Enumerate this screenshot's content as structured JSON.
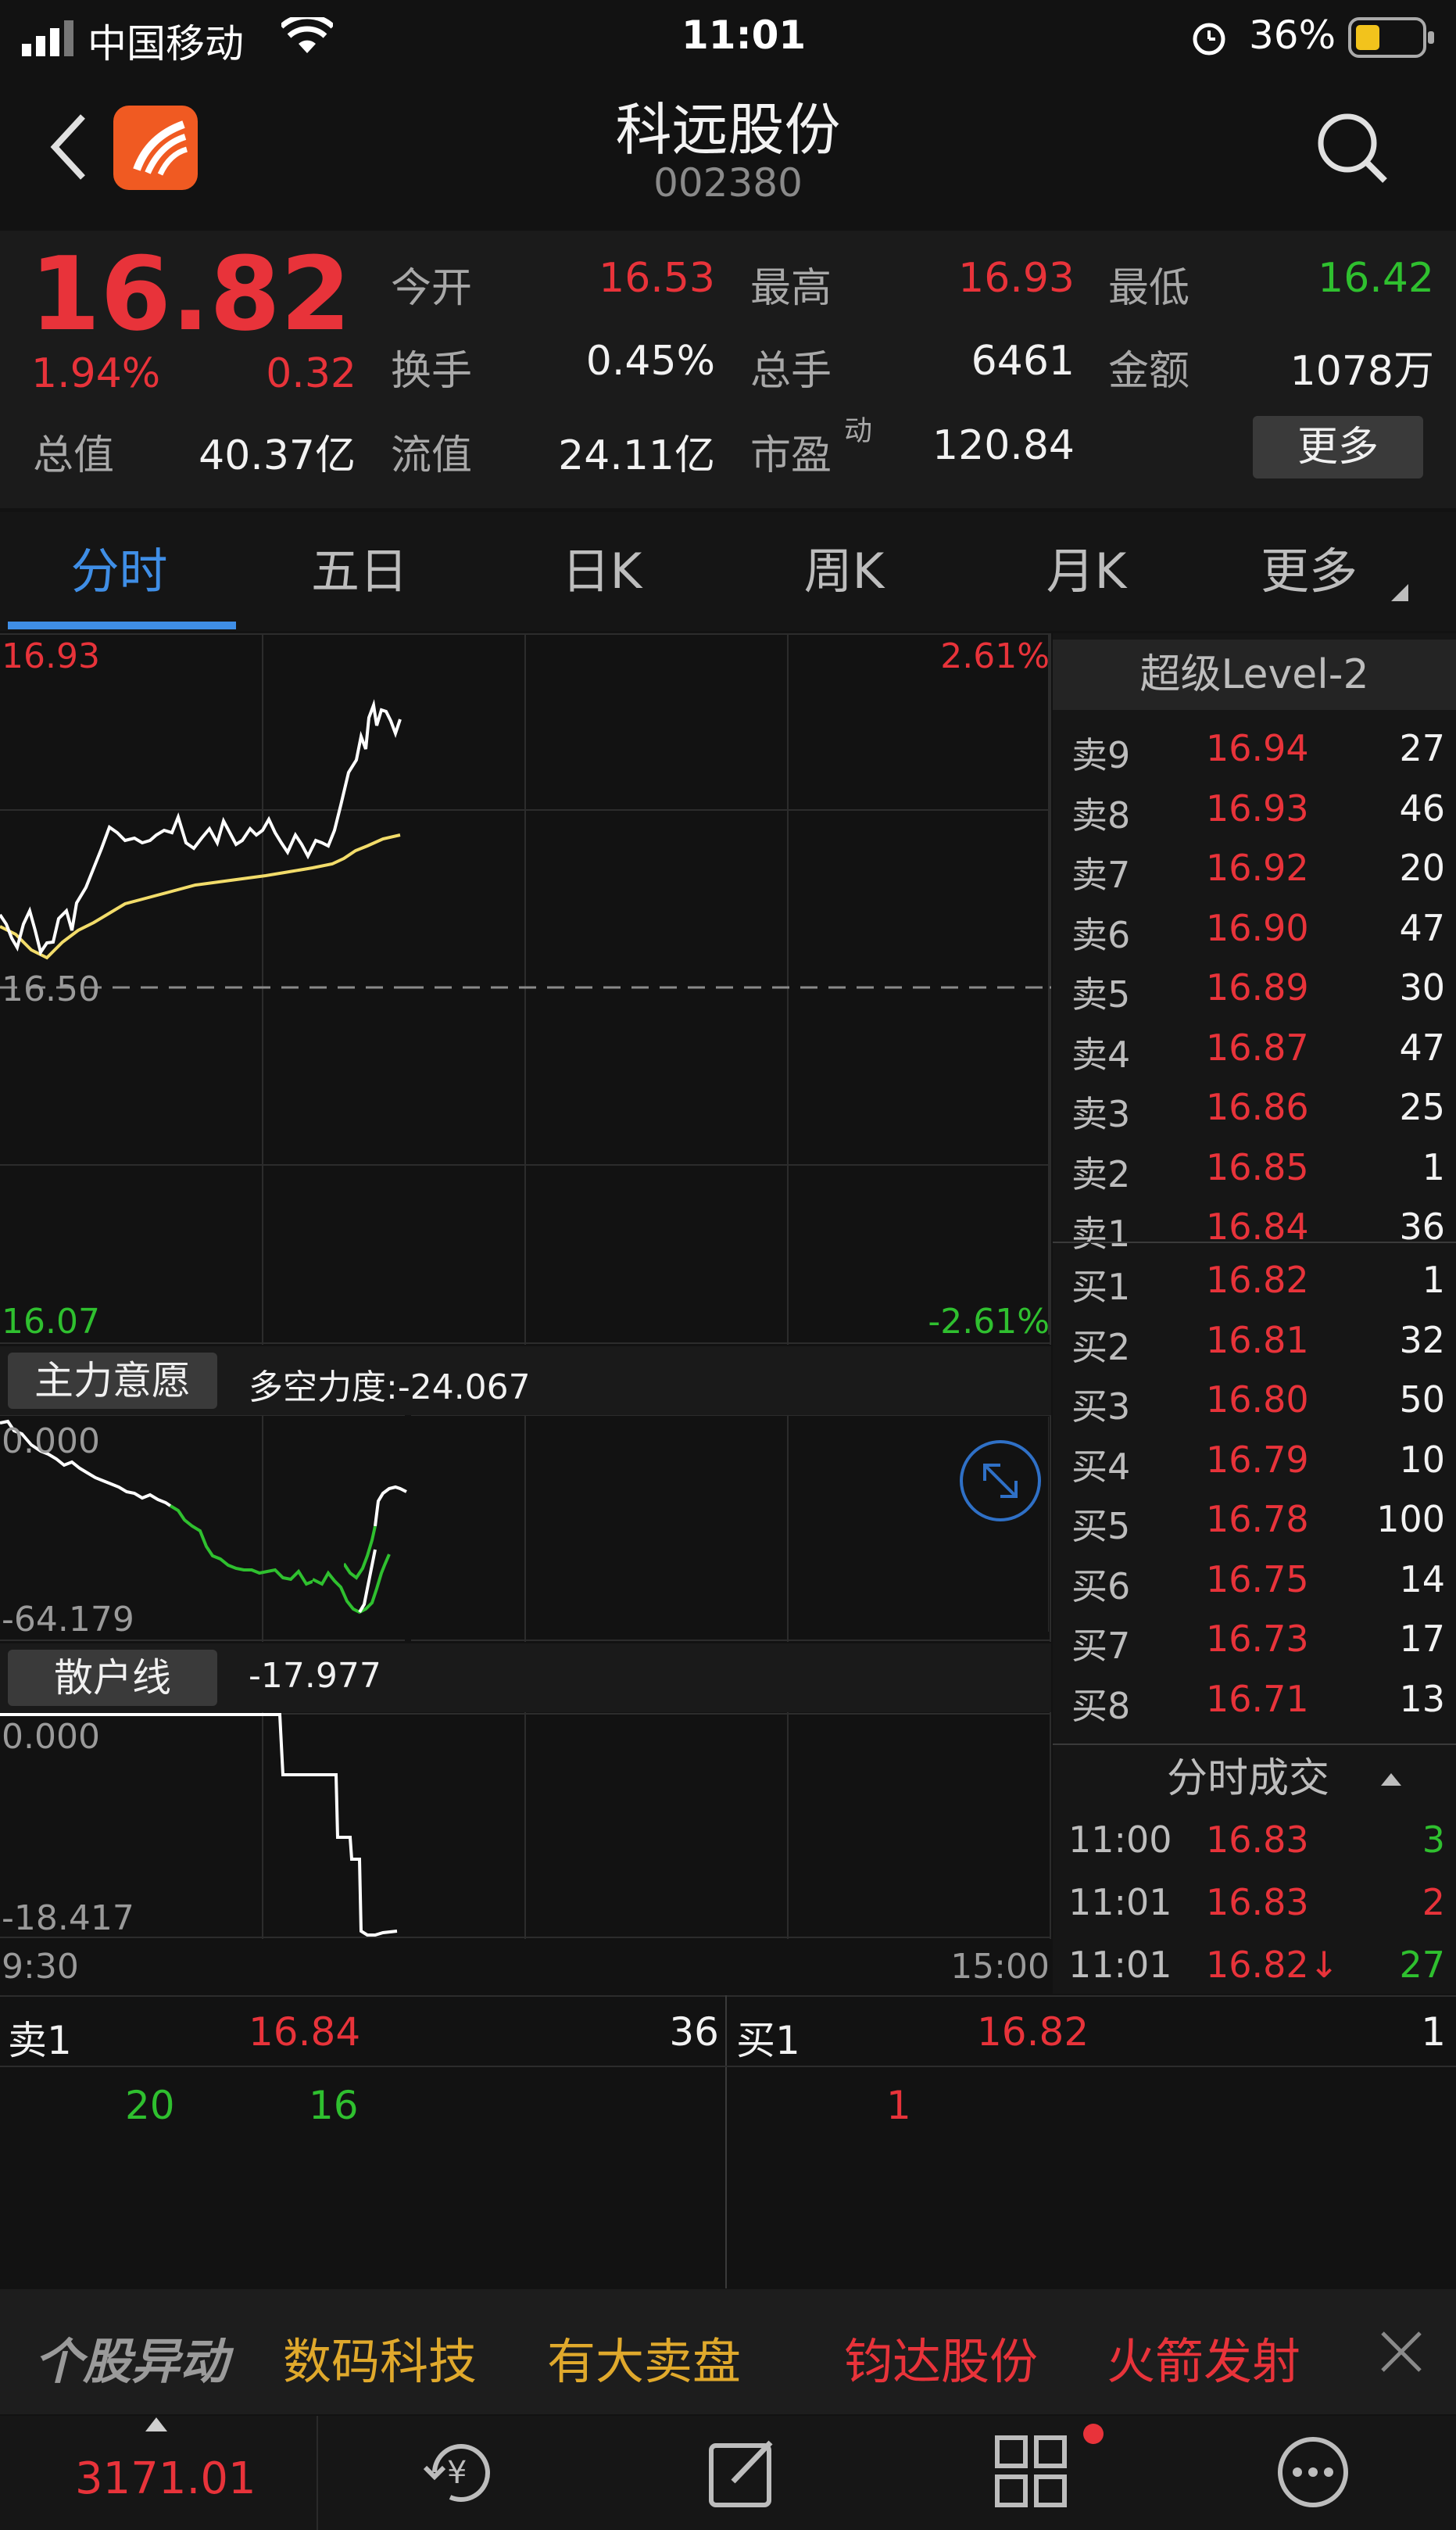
{
  "status_bar": {
    "carrier": "中国移动",
    "time": "11:01",
    "battery": "36%"
  },
  "header": {
    "title": "科远股份",
    "code": "002380"
  },
  "quote": {
    "price": "16.82",
    "change_pct": "1.94%",
    "change": "0.32",
    "rows": [
      [
        {
          "label": "今开",
          "value": "16.53",
          "color": "red"
        },
        {
          "label": "最高",
          "value": "16.93",
          "color": "red"
        },
        {
          "label": "最低",
          "value": "16.42",
          "color": "green"
        }
      ],
      [
        {
          "label": "换手",
          "value": "0.45%",
          "color": "white"
        },
        {
          "label": "总手",
          "value": "6461",
          "color": "white"
        },
        {
          "label": "金额",
          "value": "1078万",
          "color": "white"
        }
      ]
    ],
    "total_value_label": "总值",
    "total_value": "40.37亿",
    "float_value_label": "流值",
    "float_value": "24.11亿",
    "pe_label": "市盈",
    "pe_sup": "动",
    "pe_value": "120.84",
    "more_label": "更多"
  },
  "tabs": [
    "分时",
    "五日",
    "日K",
    "周K",
    "月K",
    "更多"
  ],
  "chart": {
    "price_high": "16.93",
    "pct_high": "2.61%",
    "price_mid": "16.50",
    "price_low": "16.07",
    "pct_low": "-2.61%",
    "time_start": "9:30",
    "time_end": "15:00"
  },
  "indicator1": {
    "button": "主力意愿",
    "text": "多空力度:-24.067",
    "top_val": "0.000",
    "bottom_val": "-64.179"
  },
  "indicator2": {
    "button": "散户线",
    "text": "-17.977",
    "top_val": "0.000",
    "bottom_val": "-18.417"
  },
  "order_book": {
    "title": "超级Level-2",
    "sells": [
      {
        "label": "卖9",
        "price": "16.94",
        "vol": "27"
      },
      {
        "label": "卖8",
        "price": "16.93",
        "vol": "46"
      },
      {
        "label": "卖7",
        "price": "16.92",
        "vol": "20"
      },
      {
        "label": "卖6",
        "price": "16.90",
        "vol": "47"
      },
      {
        "label": "卖5",
        "price": "16.89",
        "vol": "30"
      },
      {
        "label": "卖4",
        "price": "16.87",
        "vol": "47"
      },
      {
        "label": "卖3",
        "price": "16.86",
        "vol": "25"
      },
      {
        "label": "卖2",
        "price": "16.85",
        "vol": "1"
      },
      {
        "label": "卖1",
        "price": "16.84",
        "vol": "36"
      }
    ],
    "buys": [
      {
        "label": "买1",
        "price": "16.82",
        "vol": "1"
      },
      {
        "label": "买2",
        "price": "16.81",
        "vol": "32"
      },
      {
        "label": "买3",
        "price": "16.80",
        "vol": "50"
      },
      {
        "label": "买4",
        "price": "16.79",
        "vol": "10"
      },
      {
        "label": "买5",
        "price": "16.78",
        "vol": "100"
      },
      {
        "label": "买6",
        "price": "16.75",
        "vol": "14"
      },
      {
        "label": "买7",
        "price": "16.73",
        "vol": "17"
      },
      {
        "label": "买8",
        "price": "16.71",
        "vol": "13"
      }
    ],
    "ticks_title": "分时成交",
    "ticks": [
      {
        "time": "11:00",
        "price": "16.83",
        "vol": "3",
        "vol_color": "green"
      },
      {
        "time": "11:01",
        "price": "16.83",
        "vol": "2",
        "vol_color": "red"
      },
      {
        "time": "11:01",
        "price": "16.82↓",
        "vol": "27",
        "vol_color": "green"
      }
    ]
  },
  "depth": {
    "sell_label": "卖1",
    "sell_price": "16.84",
    "sell_vol": "36",
    "buy_label": "买1",
    "buy_price": "16.82",
    "buy_vol": "1",
    "sell_orders": [
      "20",
      "16"
    ],
    "buy_orders": [
      "1"
    ]
  },
  "ticker": {
    "items": [
      "个股异动",
      "数码科技",
      "有大卖盘",
      "钧达股份",
      "火箭发射"
    ]
  },
  "tabbar": {
    "index_value": "3171.01"
  }
}
